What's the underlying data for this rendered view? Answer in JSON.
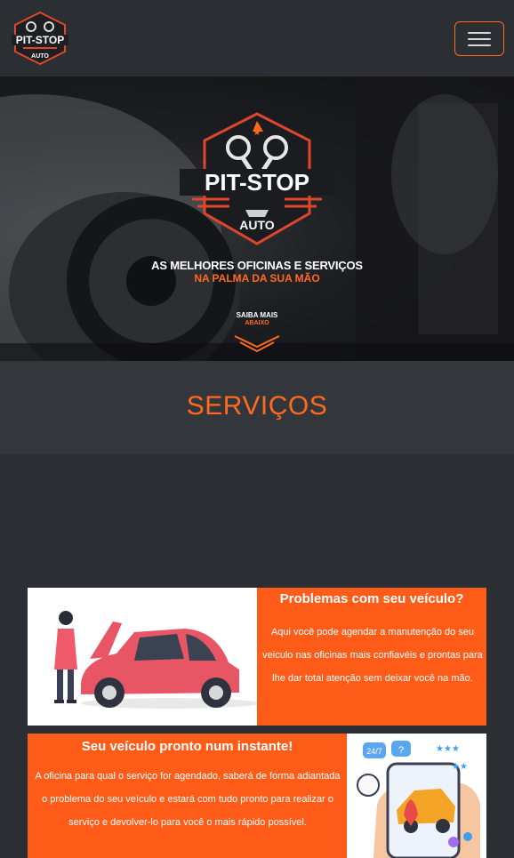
{
  "navbar": {
    "logo_text_top": "PIT-STOP",
    "logo_text_bottom": "AUTO",
    "toggler_label": ""
  },
  "hero": {
    "logo_text_top": "PIT-STOP",
    "logo_text_bottom": "AUTO",
    "tagline_line1": "AS MELHORES OFICINAS E SERVIÇOS",
    "tagline_line2": "NA PALMA DA SUA MÃO",
    "cta_line1": "SAIBA MAIS",
    "cta_line2": "ABAIXO"
  },
  "services": {
    "title": "SERVIÇOS"
  },
  "cards": [
    {
      "title": "Problemas com seu veículo?",
      "text": "Aqui você pode agendar a manutenção do seu veiculo nas oficinas mais confiavéis e prontas para lhe dar total atenção sem deixar você na mão."
    },
    {
      "title": "Seu veículo pronto num instante!",
      "text": "A oficina para qual o serviço for agendado, saberá de forma adiantada o problema do seu veículo e estará com tudo pronto para realizar o serviço e devolver-lo para você o mais rápido possível.",
      "badge": "24/7"
    }
  ],
  "colors": {
    "accent": "#ff6a1f",
    "background": "#2b2e33",
    "card": "#ff5c1a"
  }
}
